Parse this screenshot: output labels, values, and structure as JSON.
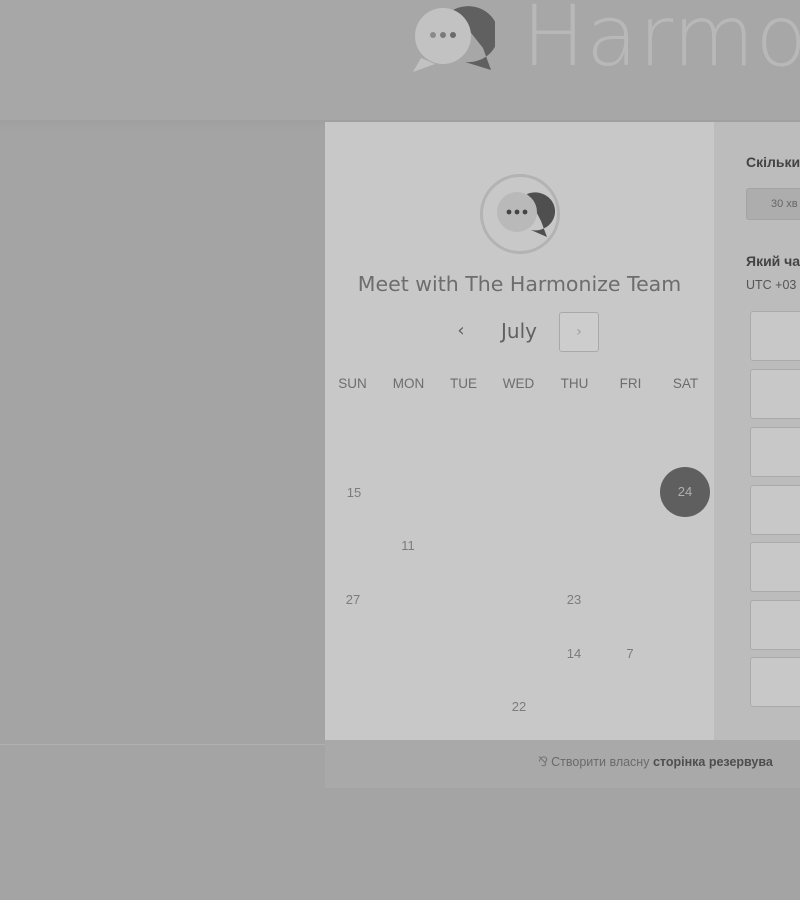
{
  "brand": {
    "name": "Harmo"
  },
  "calendar": {
    "title": "Meet with The Harmonize Team",
    "prev_symbol": "‹",
    "month": "July",
    "next_symbol": "›",
    "weekdays": [
      "SUN",
      "MON",
      "TUE",
      "WED",
      "THU",
      "FRI",
      "SAT"
    ],
    "days": [
      "15",
      "24",
      "11",
      "27",
      "23",
      "14",
      "7",
      "22"
    ],
    "selected_day": "24"
  },
  "booking": {
    "duration_heading": "Скільки",
    "duration_option": "30 хв",
    "time_heading": "Який ча",
    "timezone": "UTC +03"
  },
  "footer": {
    "sprocket_icon": "⅋",
    "text_plain": "Створити власну",
    "text_bold": "сторінка резервува"
  },
  "colors": {
    "background": "#a4a4a4",
    "panel": "#c8c8c8",
    "selected_day": "#5f5f5f"
  }
}
